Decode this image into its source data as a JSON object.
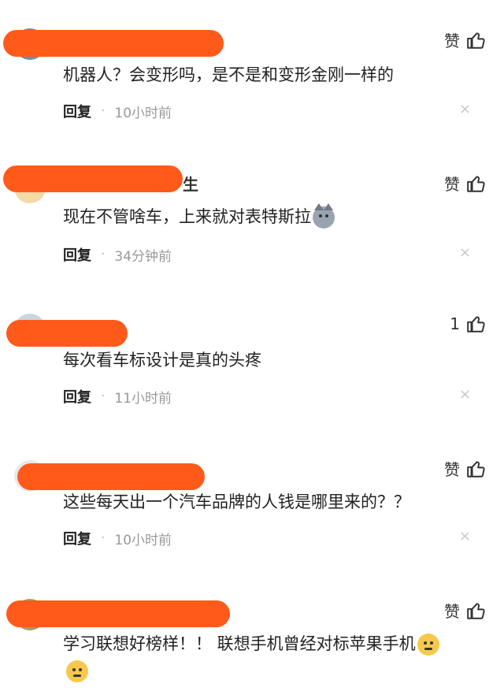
{
  "like_label": "赞",
  "reply_label": "回复",
  "separator": "·",
  "close_symbol": "×",
  "comments": [
    {
      "username": "",
      "text": "机器人？会变形吗，是不是和变形金刚一样的",
      "time": "10小时前",
      "like_text": "赞"
    },
    {
      "username": "生",
      "text": "现在不管啥车，上来就对表特斯拉",
      "emoji": "cat-face-icon",
      "time": "34分钟前",
      "like_text": "赞"
    },
    {
      "username": "",
      "text": "每次看车标设计是真的头疼",
      "time": "11小时前",
      "like_text": "1"
    },
    {
      "username": "",
      "text": "这些每天出一个汽车品牌的人钱是哪里来的？？",
      "time": "10小时前",
      "like_text": "赞"
    },
    {
      "username": "",
      "text": "学习联想好榜样！！ 联想手机曾经对标苹果手机",
      "emoji": "thinking-face-icon",
      "like_text": "赞"
    }
  ],
  "colors": {
    "redaction": "#ff5a1a",
    "meta_text": "#999999"
  }
}
